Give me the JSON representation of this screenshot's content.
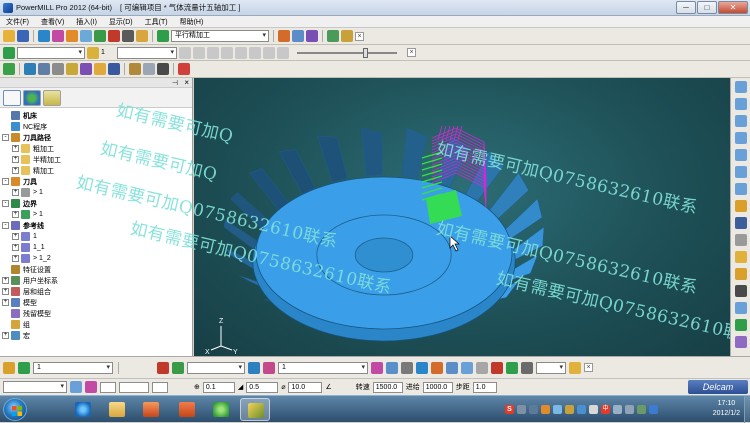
{
  "window": {
    "app_title": "PowerMILL Pro 2012 (64-bit)",
    "doc_title": "[ 可编辑项目 * 气体流量计五轴加工 ]",
    "minimize": "─",
    "maximize": "□",
    "close": "✕"
  },
  "menubar": [
    "文件(F)",
    "查看(V)",
    "插入(I)",
    "显示(D)",
    "工具(T)",
    "帮助(H)"
  ],
  "toolbar1": {
    "strategy_combo": "平行精加工"
  },
  "toolbar2": {
    "path_combo": "",
    "path_number": "1"
  },
  "explorer": {
    "tabs": [
      "explorer-tab-icon",
      "globe-tab-icon",
      "trash-tab-icon"
    ],
    "tree": [
      {
        "label": "机床",
        "level": 0,
        "bold": true,
        "expander": "",
        "icon": "machine-icon",
        "color": "#5577aa"
      },
      {
        "label": "NC程序",
        "level": 0,
        "bold": false,
        "expander": "",
        "icon": "nc-program-icon",
        "color": "#3b8fd1"
      },
      {
        "label": "刀具路径",
        "level": 0,
        "bold": true,
        "expander": "-",
        "icon": "toolpath-folder-icon",
        "color": "#c98a2a"
      },
      {
        "label": "粗加工",
        "level": 1,
        "bold": false,
        "expander": "+",
        "icon": "folder-icon",
        "color": "#e7c25a"
      },
      {
        "label": "半精加工",
        "level": 1,
        "bold": false,
        "expander": "+",
        "icon": "folder-icon",
        "color": "#e7c25a"
      },
      {
        "label": "精加工",
        "level": 1,
        "bold": false,
        "expander": "+",
        "icon": "folder-icon",
        "color": "#e7c25a"
      },
      {
        "label": "刀具",
        "level": 0,
        "bold": true,
        "expander": "-",
        "icon": "tool-icon",
        "color": "#d98b2b"
      },
      {
        "label": "> 1",
        "level": 1,
        "bold": false,
        "expander": "+",
        "icon": "endmill-icon",
        "color": "#9a9a9a"
      },
      {
        "label": "边界",
        "level": 0,
        "bold": true,
        "expander": "-",
        "icon": "boundary-icon",
        "color": "#2f8a48"
      },
      {
        "label": "> 1",
        "level": 1,
        "bold": false,
        "expander": "+",
        "icon": "boundary-item-icon",
        "color": "#3aa05b"
      },
      {
        "label": "参考线",
        "level": 0,
        "bold": true,
        "expander": "-",
        "icon": "pattern-icon",
        "color": "#6c6cbf"
      },
      {
        "label": "1",
        "level": 1,
        "bold": false,
        "expander": "+",
        "icon": "pattern-item-icon",
        "color": "#7d7dd0"
      },
      {
        "label": "1_1",
        "level": 1,
        "bold": false,
        "expander": "+",
        "icon": "pattern-item-icon",
        "color": "#7d7dd0"
      },
      {
        "label": "> 1_2",
        "level": 1,
        "bold": false,
        "expander": "+",
        "icon": "pattern-item-icon",
        "color": "#7d7dd0"
      },
      {
        "label": "特征设置",
        "level": 0,
        "bold": false,
        "expander": "",
        "icon": "feature-icon",
        "color": "#b0862e"
      },
      {
        "label": "用户坐标系",
        "level": 0,
        "bold": false,
        "expander": "+",
        "icon": "workplane-icon",
        "color": "#5a8f5a"
      },
      {
        "label": "层和组合",
        "level": 0,
        "bold": false,
        "expander": "+",
        "icon": "layers-icon",
        "color": "#c25b5b"
      },
      {
        "label": "模型",
        "level": 0,
        "bold": false,
        "expander": "+",
        "icon": "model-icon",
        "color": "#5a7fbf"
      },
      {
        "label": "残留模型",
        "level": 0,
        "bold": false,
        "expander": "",
        "icon": "stock-model-icon",
        "color": "#8a6fc1"
      },
      {
        "label": "组",
        "level": 0,
        "bold": false,
        "expander": "",
        "icon": "group-icon",
        "color": "#d3a53a"
      },
      {
        "label": "宏",
        "level": 0,
        "bold": false,
        "expander": "+",
        "icon": "macro-icon",
        "color": "#4f8fbf"
      }
    ]
  },
  "viewport": {
    "axis_labels": {
      "z": "Z",
      "x": "X",
      "y": "Y"
    },
    "watermarks": [
      "如有需要可加Q",
      "如有需要可加Q",
      "如有需要可加Q0758632610联系",
      "如有需要可加Q0758632610联系",
      "如有需要可加Q0758632610联系",
      "如有需要可加Q0758632610联系",
      "如有需要可加Q0758632610联系"
    ]
  },
  "bottom_toolbar1": {
    "tool_number": "1",
    "combo2": "",
    "combo3": "1",
    "combo4": ""
  },
  "bottom_toolbar2": {
    "tolerance": "0.1",
    "stock": "0.5",
    "diameter": "10.0",
    "speed_label": "转速",
    "speed_value": "1500.0",
    "feed_label": "进给",
    "feed_value": "1000.0",
    "stepover_label": "步距",
    "stepover_value": "1.0",
    "brand": "Delcam"
  },
  "taskbar": {
    "time": "17:10",
    "date": "2012/1/2",
    "ime_label": "中",
    "tray_s_label": "S"
  },
  "colors": {
    "viewport_bg": "#1e5057",
    "blade_blue": "#3a9fe8",
    "toolpath_magenta": "#d12ad6",
    "toolpath_green": "#33e63a",
    "watermark": "#7fe0d8"
  }
}
